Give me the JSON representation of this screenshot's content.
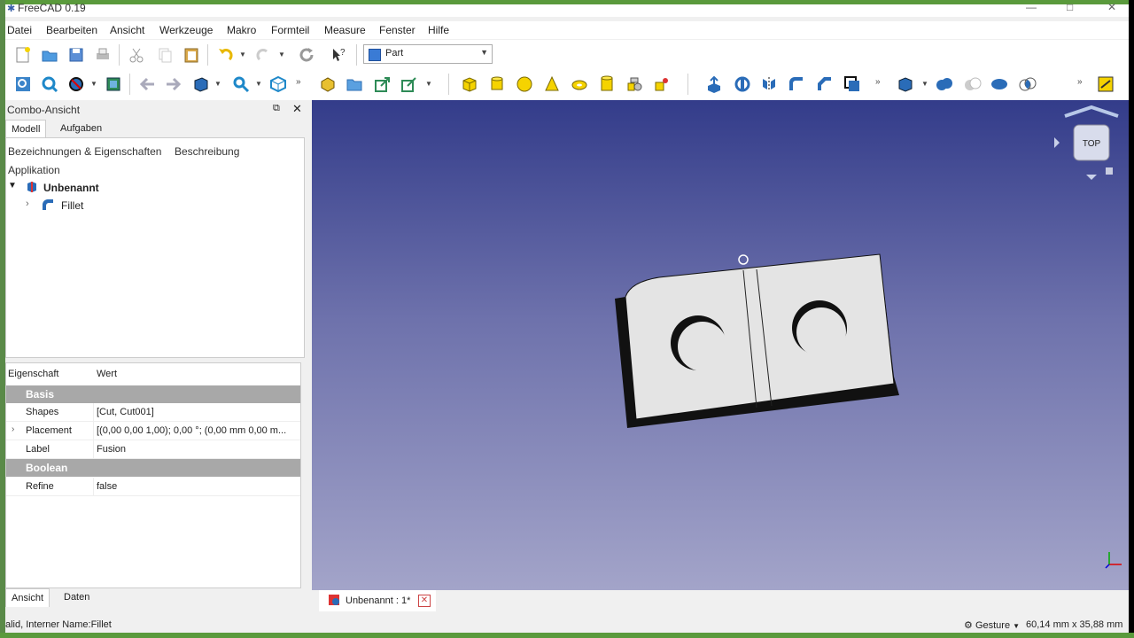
{
  "window": {
    "title": "FreeCAD 0.19",
    "minimize": "—",
    "maximize": "□",
    "close": "✕"
  },
  "menu": [
    "Datei",
    "Bearbeiten",
    "Ansicht",
    "Werkzeuge",
    "Makro",
    "Formteil",
    "Measure",
    "Fenster",
    "Hilfe"
  ],
  "workbench": {
    "selected": "Part"
  },
  "combo": {
    "title": "Combo-Ansicht",
    "tabs": [
      "Modell",
      "Aufgaben"
    ],
    "tree_headers": [
      "Bezeichnungen & Eigenschaften",
      "Beschreibung"
    ],
    "application_label": "Applikation",
    "document": "Unbenannt",
    "child": "Fillet",
    "bottom_tabs": [
      "Ansicht",
      "Daten"
    ]
  },
  "properties": {
    "header_property": "Eigenschaft",
    "header_value": "Wert",
    "groups": [
      {
        "name": "Basis",
        "rows": [
          {
            "key": "Shapes",
            "value": "[Cut, Cut001]"
          },
          {
            "key": "Placement",
            "value": "[(0,00 0,00 1,00); 0,00 °; (0,00 mm  0,00 m..."
          },
          {
            "key": "Label",
            "value": "Fusion"
          }
        ]
      },
      {
        "name": "Boolean",
        "rows": [
          {
            "key": "Refine",
            "value": "false"
          }
        ]
      }
    ]
  },
  "viewport": {
    "navcube_face": "TOP"
  },
  "doc_tab": {
    "label": "Unbenannt : 1*"
  },
  "status": {
    "left": "alid, Interner Name:Fillet",
    "navigation": "Gesture",
    "dimensions": "60,14 mm x 35,88 mm"
  },
  "colors": {
    "viewport_top": "#333c8a",
    "viewport_bottom": "#a3a4c9",
    "group_bg": "#a8a8a8",
    "frame": "#5a9a3c"
  }
}
